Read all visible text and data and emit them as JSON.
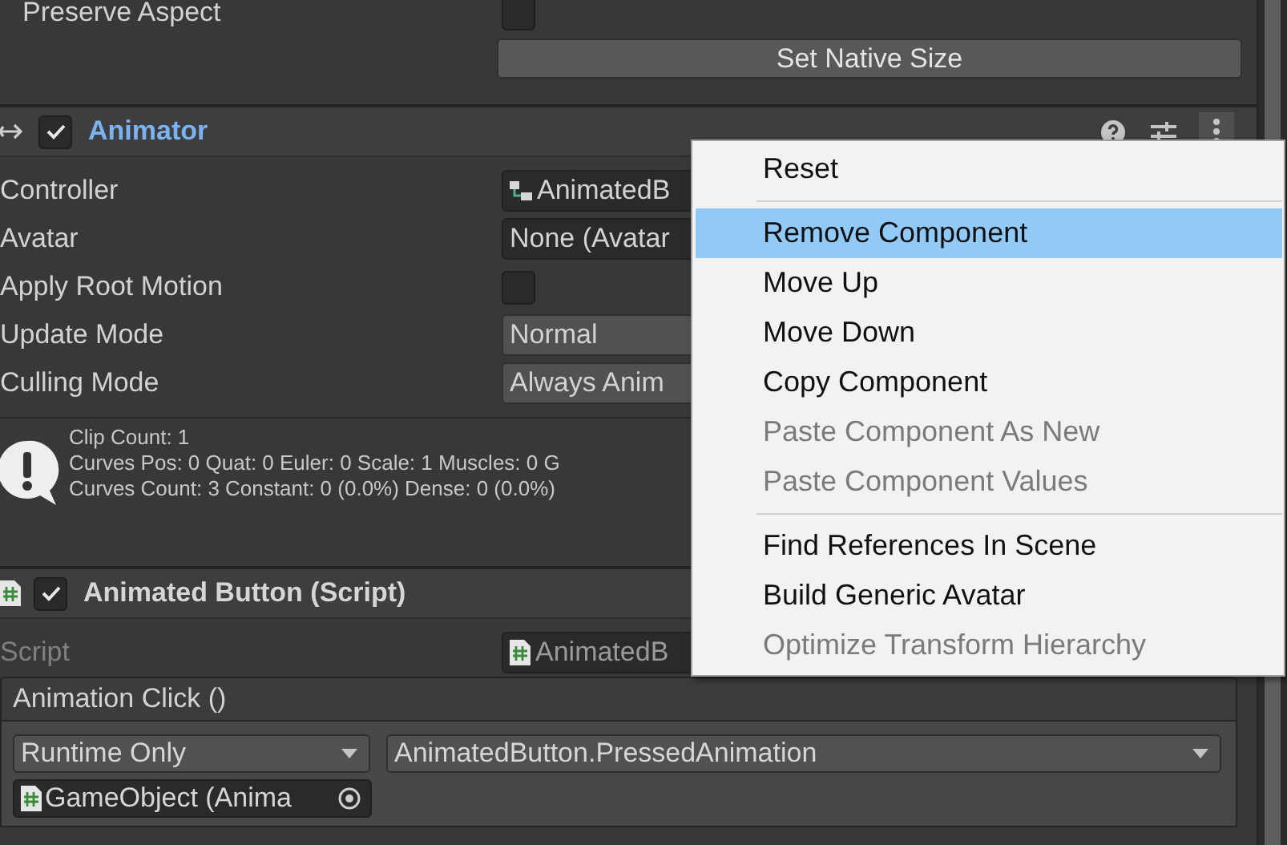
{
  "preserve_aspect": {
    "label": "Preserve Aspect",
    "checked": false
  },
  "set_native_size": "Set Native Size",
  "animator": {
    "title": "Animator",
    "enabled": true,
    "fields": [
      {
        "kind": "asset",
        "label": "Controller",
        "value": "AnimatedB"
      },
      {
        "kind": "object",
        "label": "Avatar",
        "value": "None (Avatar"
      },
      {
        "kind": "checkbox",
        "label": "Apply Root Motion",
        "checked": false
      },
      {
        "kind": "dropdown",
        "label": "Update Mode",
        "value": "Normal"
      },
      {
        "kind": "dropdown",
        "label": "Culling Mode",
        "value": "Always Anim"
      }
    ],
    "info": [
      "Clip Count: 1",
      "Curves Pos: 0 Quat: 0 Euler: 0 Scale: 1 Muscles: 0 G",
      "Curves Count: 3 Constant: 0 (0.0%) Dense: 0 (0.0%)"
    ]
  },
  "script_component": {
    "title": "Animated Button (Script)",
    "enabled": true,
    "script": {
      "label": "Script",
      "value": "AnimatedB",
      "disabled": true
    },
    "event": {
      "title": "Animation Click ()",
      "mode": "Runtime Only",
      "function": "AnimatedButton.PressedAnimation",
      "target": "GameObject (Anima"
    }
  },
  "context_menu": [
    {
      "label": "Reset",
      "disabled": false,
      "selected": false,
      "separator_after": true
    },
    {
      "label": "Remove Component",
      "disabled": false,
      "selected": true,
      "separator_after": false
    },
    {
      "label": "Move Up",
      "disabled": false,
      "selected": false,
      "separator_after": false
    },
    {
      "label": "Move Down",
      "disabled": false,
      "selected": false,
      "separator_after": false
    },
    {
      "label": "Copy Component",
      "disabled": false,
      "selected": false,
      "separator_after": false
    },
    {
      "label": "Paste Component As New",
      "disabled": true,
      "selected": false,
      "separator_after": false
    },
    {
      "label": "Paste Component Values",
      "disabled": true,
      "selected": false,
      "separator_after": true
    },
    {
      "label": "Find References In Scene",
      "disabled": false,
      "selected": false,
      "separator_after": false
    },
    {
      "label": "Build Generic Avatar",
      "disabled": false,
      "selected": false,
      "separator_after": false
    },
    {
      "label": "Optimize Transform Hierarchy",
      "disabled": true,
      "selected": false,
      "separator_after": false
    }
  ]
}
